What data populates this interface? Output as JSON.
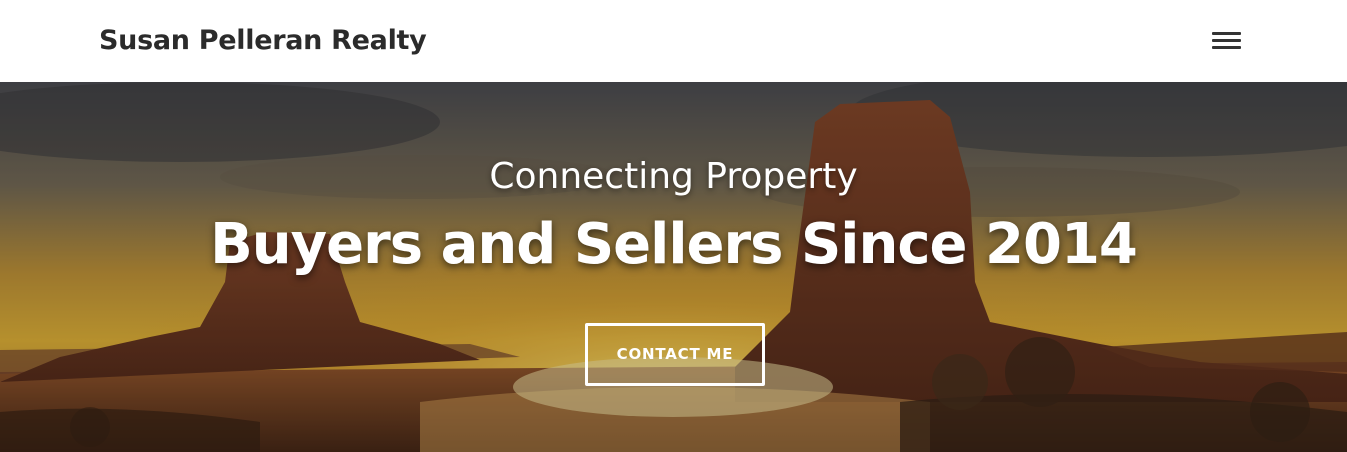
{
  "navbar": {
    "brand": "Susan Pelleran Realty",
    "menu_icon": "hamburger-menu-icon"
  },
  "hero": {
    "background": "desert-monument-valley-sunset-image",
    "subheading": "Connecting Property",
    "heading": "Buyers and Sellers Since 2014",
    "cta_label": "CONTACT ME"
  },
  "colors": {
    "brand_text": "#2b2b2b",
    "hero_text": "#ffffff",
    "button_border": "#ffffff",
    "navbar_bg": "#ffffff"
  }
}
